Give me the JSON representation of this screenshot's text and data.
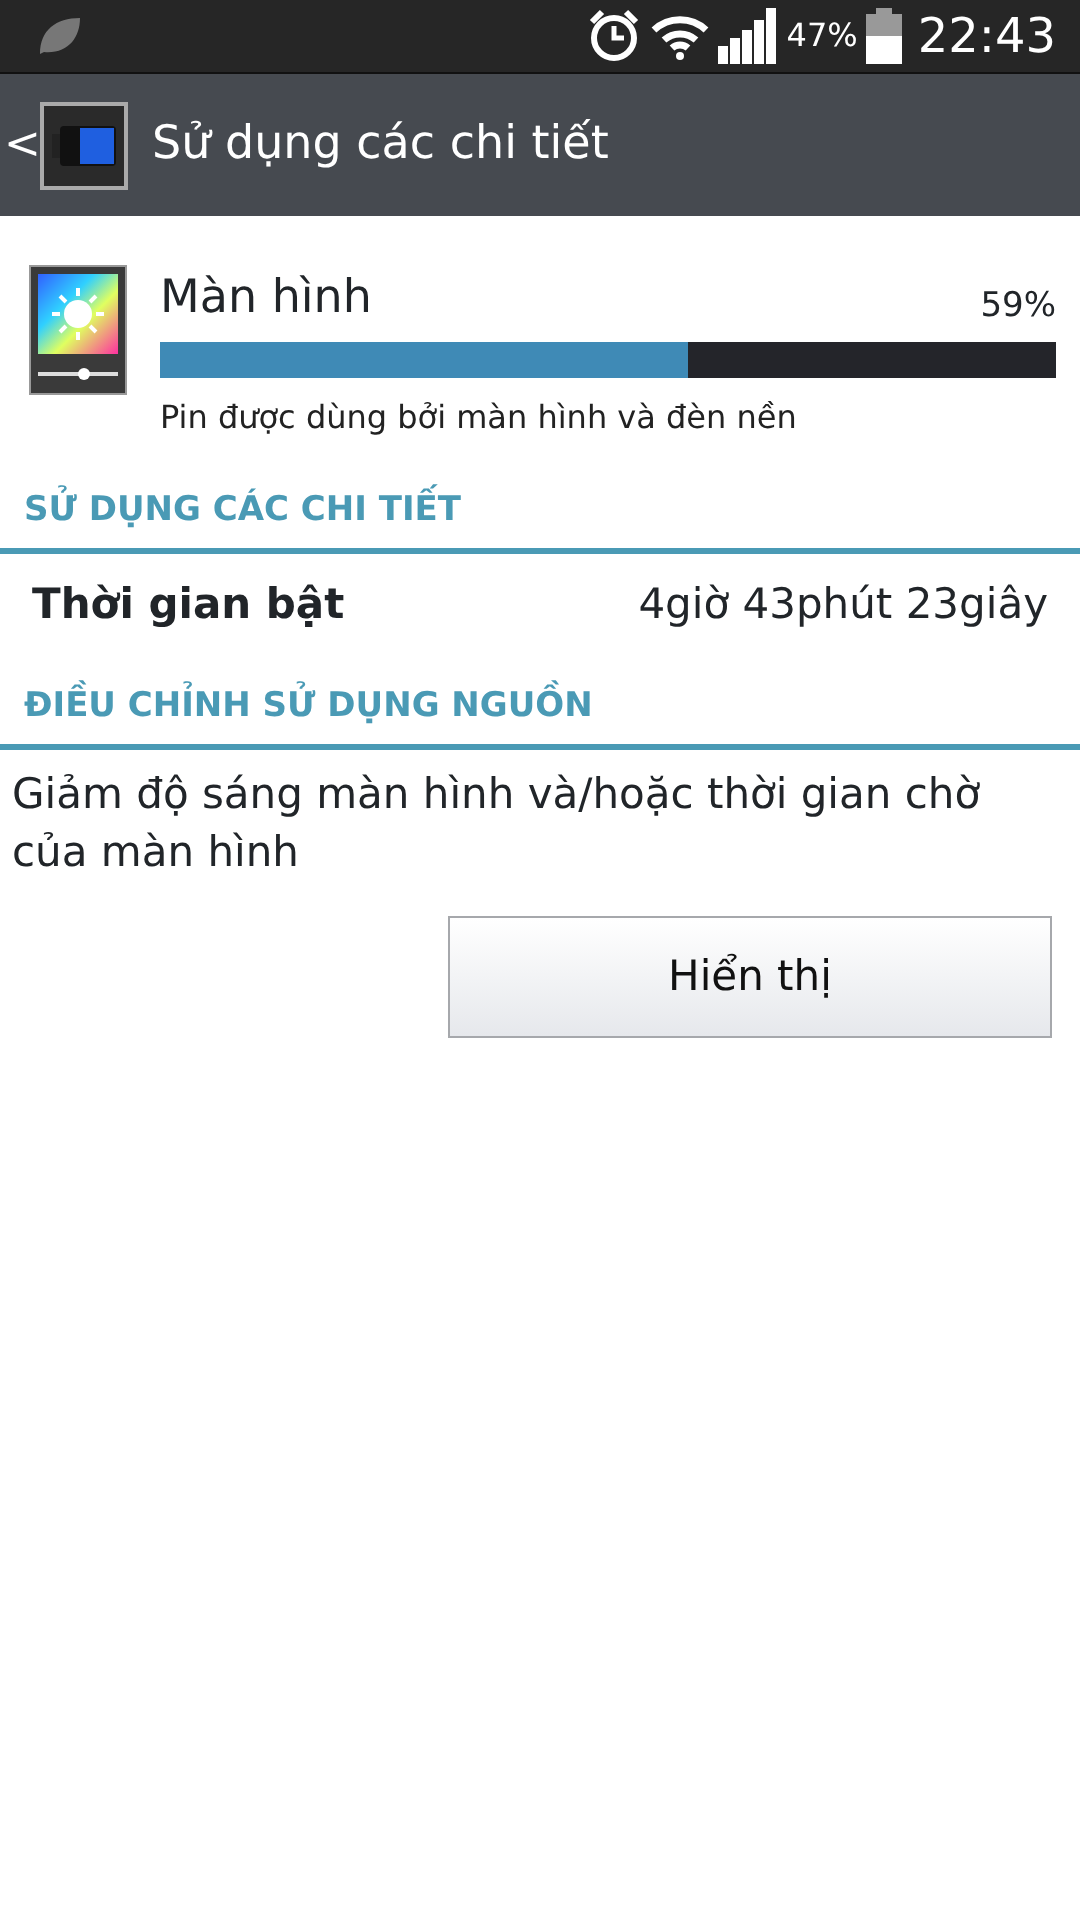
{
  "status_bar": {
    "battery_percent": "47%",
    "time": "22:43"
  },
  "action_bar": {
    "back": "<",
    "title": "Sử dụng các chi tiết"
  },
  "usage_item": {
    "name": "Màn hình",
    "percent": "59%",
    "level": 0.59,
    "description": "Pin được dùng bởi màn hình và đèn nền"
  },
  "sections": [
    {
      "header": "SỬ DỤNG CÁC CHI TIẾT",
      "kind": "detail",
      "label": "Thời gian bật",
      "value": "4giờ 43phút 23giây"
    },
    {
      "header": "ĐIỀU CHỈNH SỬ DỤNG NGUỒN",
      "kind": "action",
      "text": "Giảm độ sáng màn hình và/hoặc thời gian chờ của màn hình",
      "button": "Hiển thị"
    }
  ]
}
